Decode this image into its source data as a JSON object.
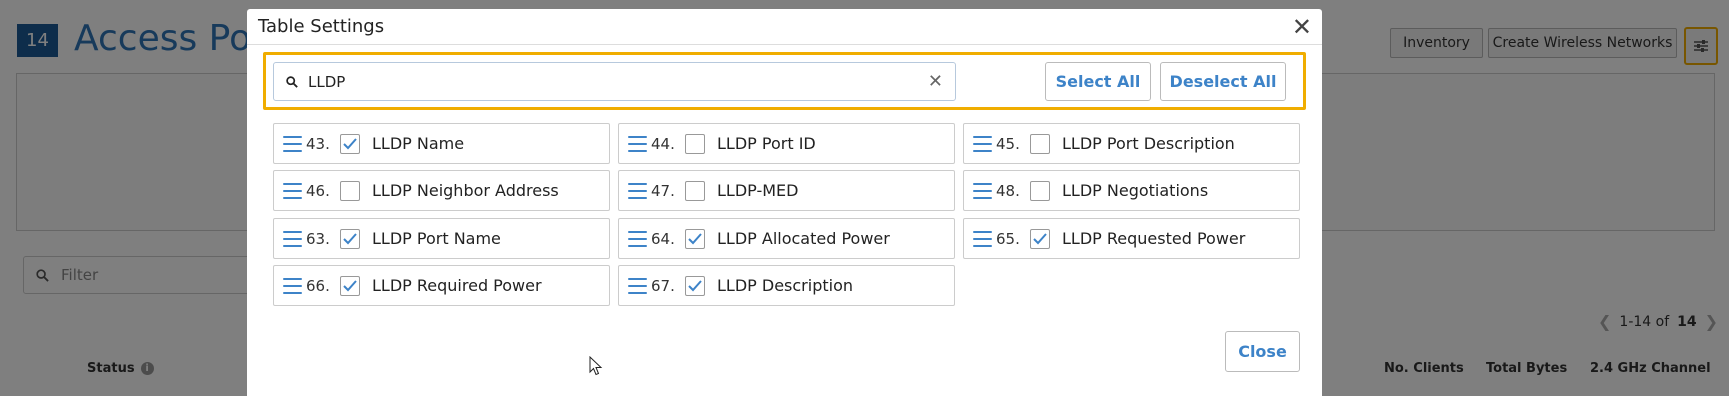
{
  "background": {
    "count": "14",
    "page_title": "Access Poir",
    "buttons": {
      "inventory": "Inventory",
      "create_wireless": "Create Wireless Networks"
    },
    "filter_placeholder": "Filter",
    "pager": {
      "range": "1-14 of",
      "total": "14"
    },
    "columns": {
      "status": "Status",
      "no_clients": "No. Clients",
      "total_bytes": "Total Bytes",
      "channel_24": "2.4 GHz Channel"
    }
  },
  "modal": {
    "title": "Table Settings",
    "search": {
      "value": "LLDP"
    },
    "select_all": "Select All",
    "deselect_all": "Deselect All",
    "close": "Close",
    "items": [
      {
        "num": "43.",
        "label": "LLDP Name",
        "checked": true
      },
      {
        "num": "44.",
        "label": "LLDP Port ID",
        "checked": false
      },
      {
        "num": "45.",
        "label": "LLDP Port Description",
        "checked": false
      },
      {
        "num": "46.",
        "label": "LLDP Neighbor Address",
        "checked": false
      },
      {
        "num": "47.",
        "label": "LLDP-MED",
        "checked": false
      },
      {
        "num": "48.",
        "label": "LLDP Negotiations",
        "checked": false
      },
      {
        "num": "63.",
        "label": "LLDP Port Name",
        "checked": true
      },
      {
        "num": "64.",
        "label": "LLDP Allocated Power",
        "checked": true
      },
      {
        "num": "65.",
        "label": "LLDP Requested Power",
        "checked": true
      },
      {
        "num": "66.",
        "label": "LLDP Required Power",
        "checked": true
      },
      {
        "num": "67.",
        "label": "LLDP Description",
        "checked": true
      }
    ]
  },
  "colors": {
    "accent": "#3d83c8",
    "highlight": "#f0ad00",
    "badge": "#1d5a96"
  }
}
